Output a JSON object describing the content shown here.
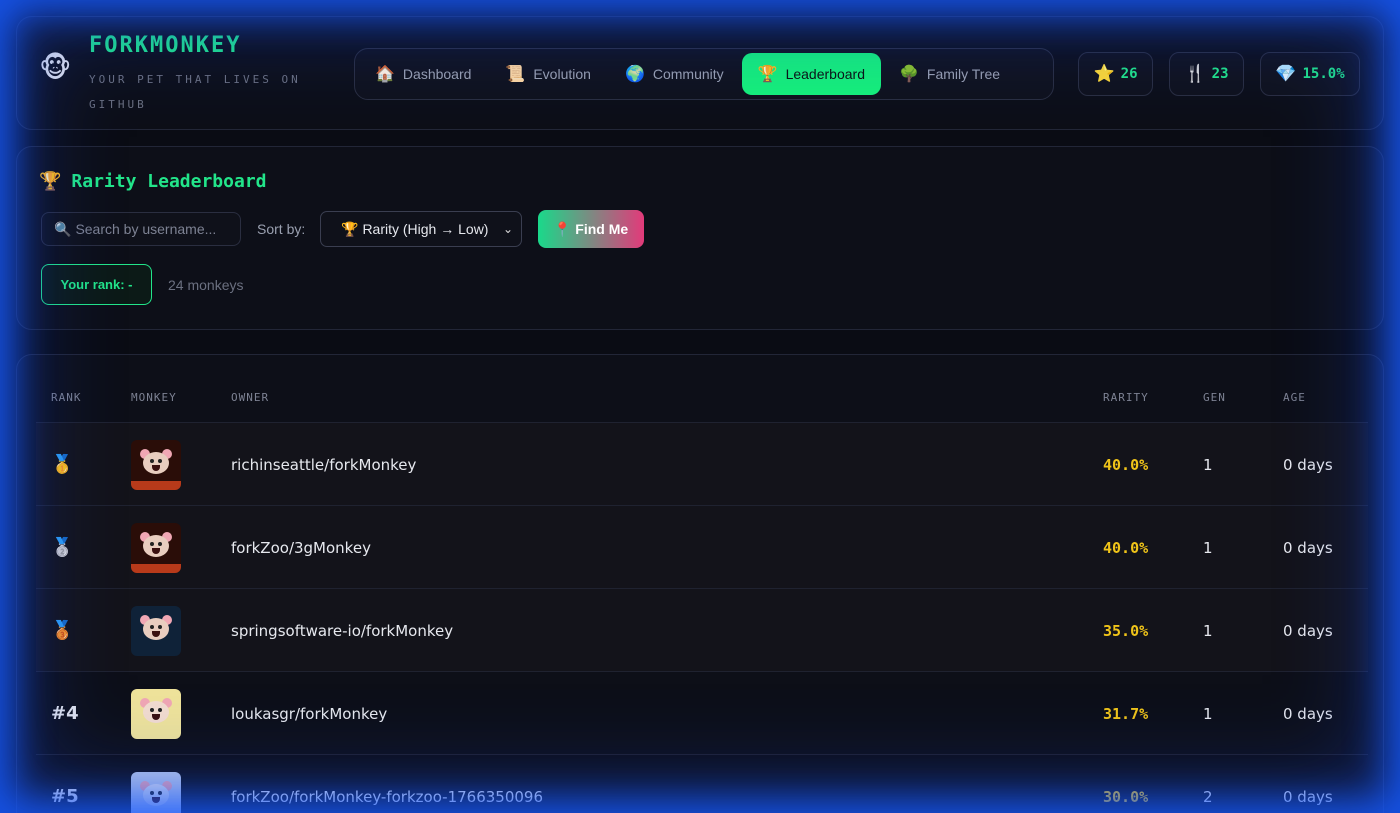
{
  "header": {
    "logo_icon": "🐵",
    "title": "FORKMONKEY",
    "subtitle": "YOUR PET THAT LIVES ON GITHUB",
    "nav": [
      {
        "icon": "🏠",
        "label": "Dashboard",
        "active": false
      },
      {
        "icon": "📜",
        "label": "Evolution",
        "active": false
      },
      {
        "icon": "🌍",
        "label": "Community",
        "active": false
      },
      {
        "icon": "🏆",
        "label": "Leaderboard",
        "active": true
      },
      {
        "icon": "🌳",
        "label": "Family Tree",
        "active": false
      }
    ],
    "stats": [
      {
        "icon": "⭐",
        "value": "26",
        "name": "stars"
      },
      {
        "icon": "🍴",
        "value": "23",
        "name": "forks"
      },
      {
        "icon": "💎",
        "value": "15.0%",
        "name": "rarity"
      }
    ]
  },
  "controls": {
    "title_icon": "🏆",
    "title": "Rarity Leaderboard",
    "search_icon": "🔍",
    "search_placeholder": "Search by username...",
    "sort_label": "Sort by:",
    "sort_icon": "🏆",
    "sort_value": "Rarity (High → Low)",
    "find_me_icon": "📍",
    "find_me_label": "Find Me",
    "your_rank": "Your rank: -",
    "count": "24 monkeys"
  },
  "table": {
    "headers": {
      "rank": "RANK",
      "monkey": "MONKEY",
      "owner": "OWNER",
      "rarity": "RARITY",
      "gen": "GEN",
      "age": "AGE"
    },
    "rows": [
      {
        "rank": "🥇",
        "owner": "richinseattle/forkMonkey",
        "rarity": "40.0%",
        "gen": "1",
        "age": "0 days",
        "bg": "#2a0d08",
        "face": "#e8cdbf"
      },
      {
        "rank": "🥈",
        "owner": "forkZoo/3gMonkey",
        "rarity": "40.0%",
        "gen": "1",
        "age": "0 days",
        "bg": "#2a0d08",
        "face": "#e8cdbf"
      },
      {
        "rank": "🥉",
        "owner": "springsoftware-io/forkMonkey",
        "rarity": "35.0%",
        "gen": "1",
        "age": "0 days",
        "bg": "#0f2238",
        "face": "#e8cdbf"
      },
      {
        "rank": "#4",
        "owner": "loukasgr/forkMonkey",
        "rarity": "31.7%",
        "gen": "1",
        "age": "0 days",
        "bg": "#efe39a",
        "face": "#f2dccf"
      },
      {
        "rank": "#5",
        "owner": "forkZoo/forkMonkey-forkzoo-1766350096",
        "rarity": "30.0%",
        "gen": "2",
        "age": "0 days",
        "bg": "#b9c8ea",
        "face": "#dde2ee"
      }
    ]
  }
}
